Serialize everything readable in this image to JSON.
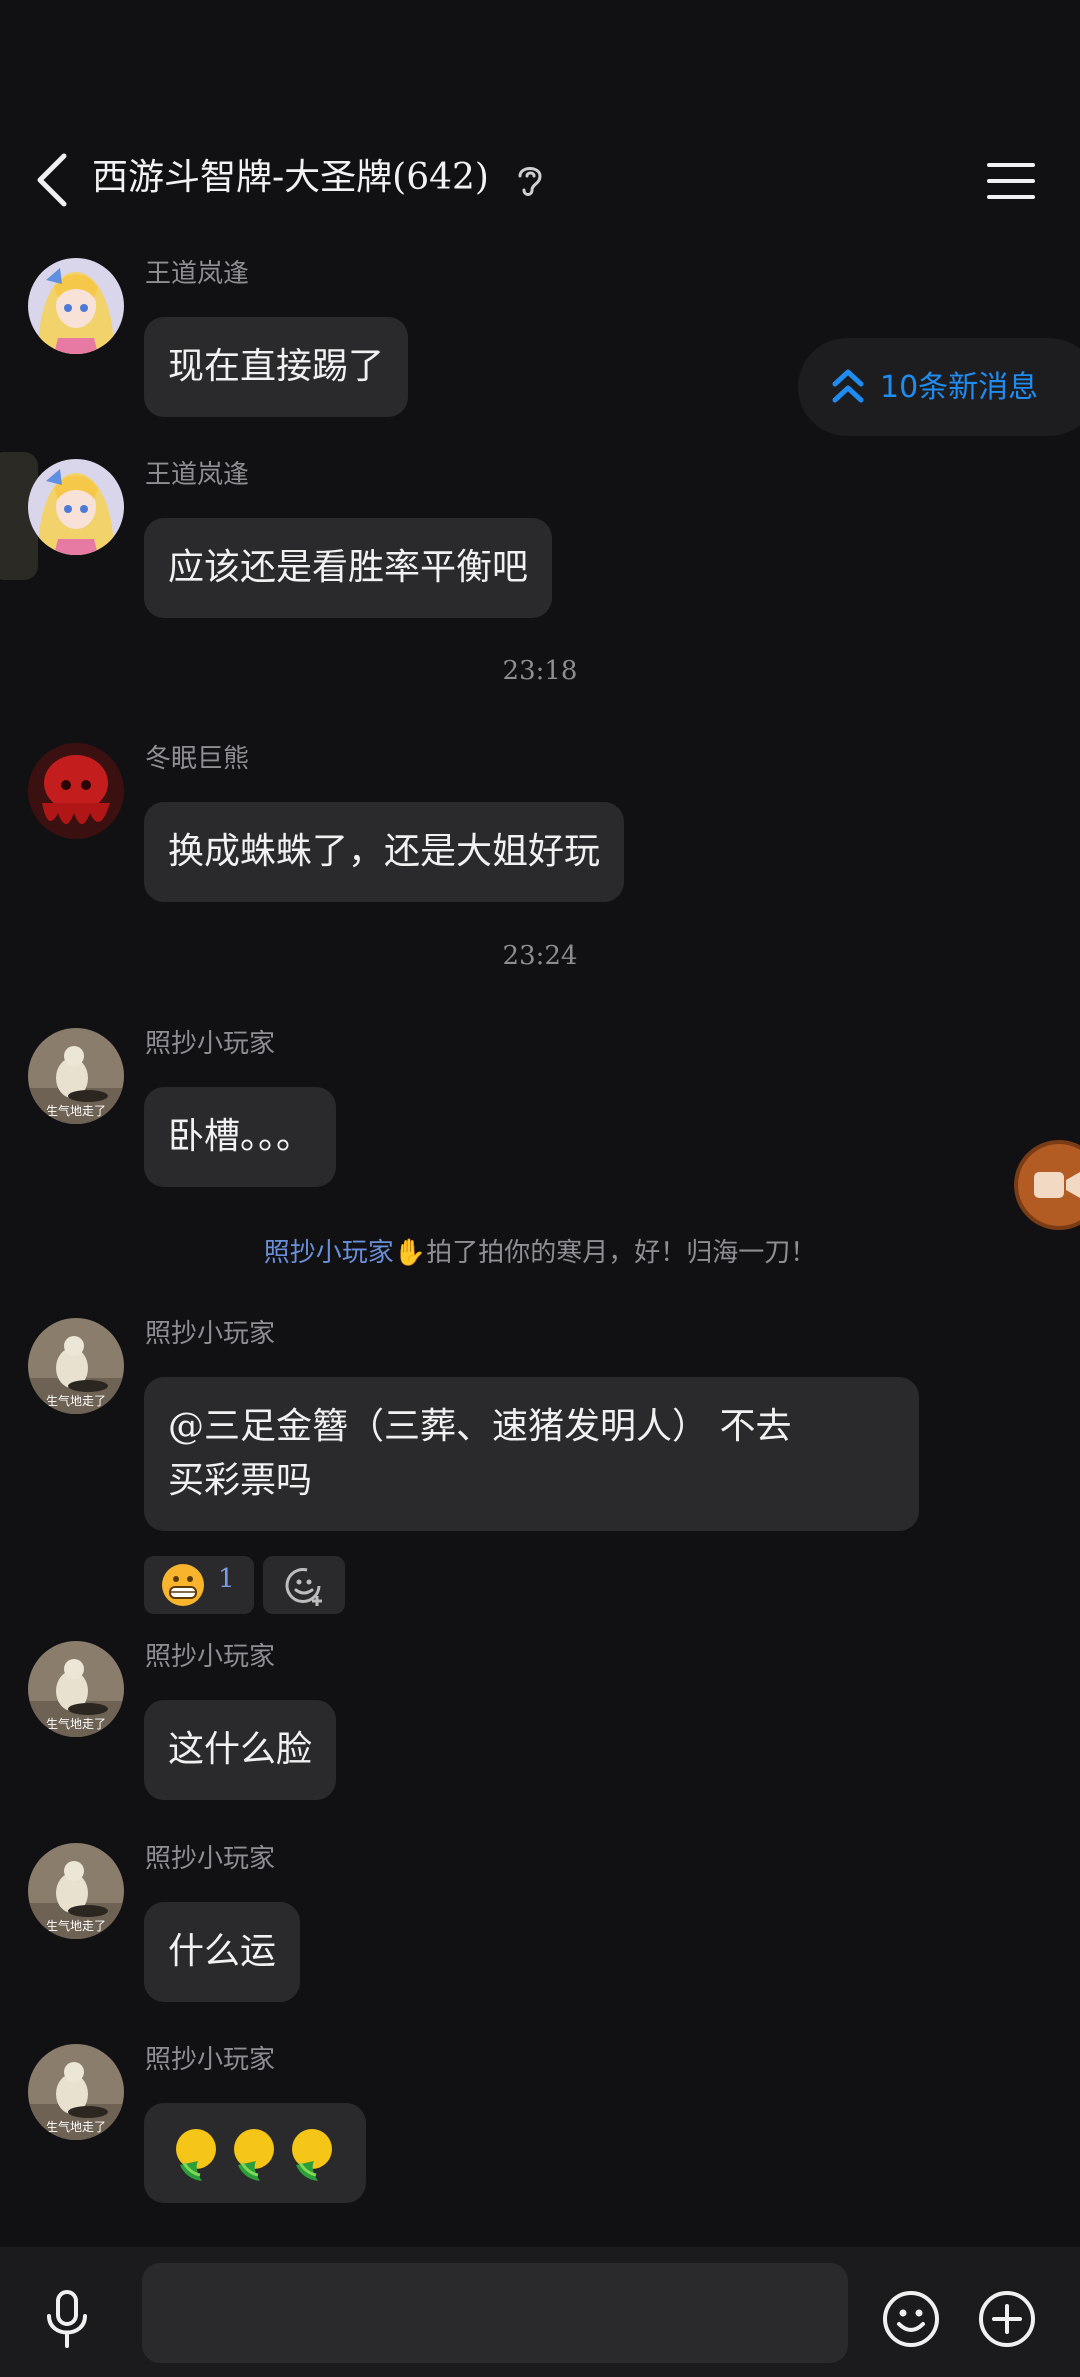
{
  "header": {
    "title": "西游斗智牌-大圣牌(642)",
    "back_icon": "chevron-left-icon",
    "ear_icon": "ear-icon",
    "menu_icon": "hamburger-menu-icon"
  },
  "new_messages": {
    "label": "10条新消息",
    "icon": "double-chevron-up-icon",
    "color": "#1e8cf0"
  },
  "messages": [
    {
      "sender": "王道岚逢",
      "text": "现在直接踢了",
      "avatar": "anime-girl-avatar"
    },
    {
      "sender": "王道岚逢",
      "text": "应该还是看胜率平衡吧",
      "avatar": "anime-girl-avatar"
    },
    {
      "time": "23:18"
    },
    {
      "sender": "冬眠巨熊",
      "text": "换成蛛蛛了，还是大姐好玩",
      "avatar": "red-octopus-avatar"
    },
    {
      "time": "23:24"
    },
    {
      "sender": "照抄小玩家",
      "text": "卧槽。。。",
      "avatar": "duck-avatar",
      "avatar_text": "生气地走了"
    },
    {
      "notice_link": "照抄小玩家",
      "notice_text": "拍了拍你的寒月，好！归海一刀！"
    },
    {
      "sender": "照抄小玩家",
      "text_line1": "@三足金簪（三葬、速猪发明人） 不去",
      "text_line2": "买彩票吗",
      "avatar": "duck-avatar",
      "avatar_text": "生气地走了",
      "reaction_count": "1"
    },
    {
      "sender": "照抄小玩家",
      "text": "这什么脸",
      "avatar": "duck-avatar",
      "avatar_text": "生气地走了"
    },
    {
      "sender": "照抄小玩家",
      "text": "什么运",
      "avatar": "duck-avatar",
      "avatar_text": "生气地走了"
    },
    {
      "sender": "照抄小玩家",
      "text": "",
      "avatar": "duck-avatar",
      "avatar_text": "生气地走了",
      "emoji": "mango-emoji"
    }
  ],
  "bottom_bar": {
    "mic_icon": "microphone-icon",
    "emoji_icon": "smiley-icon",
    "plus_icon": "plus-circle-icon",
    "input_value": ""
  }
}
